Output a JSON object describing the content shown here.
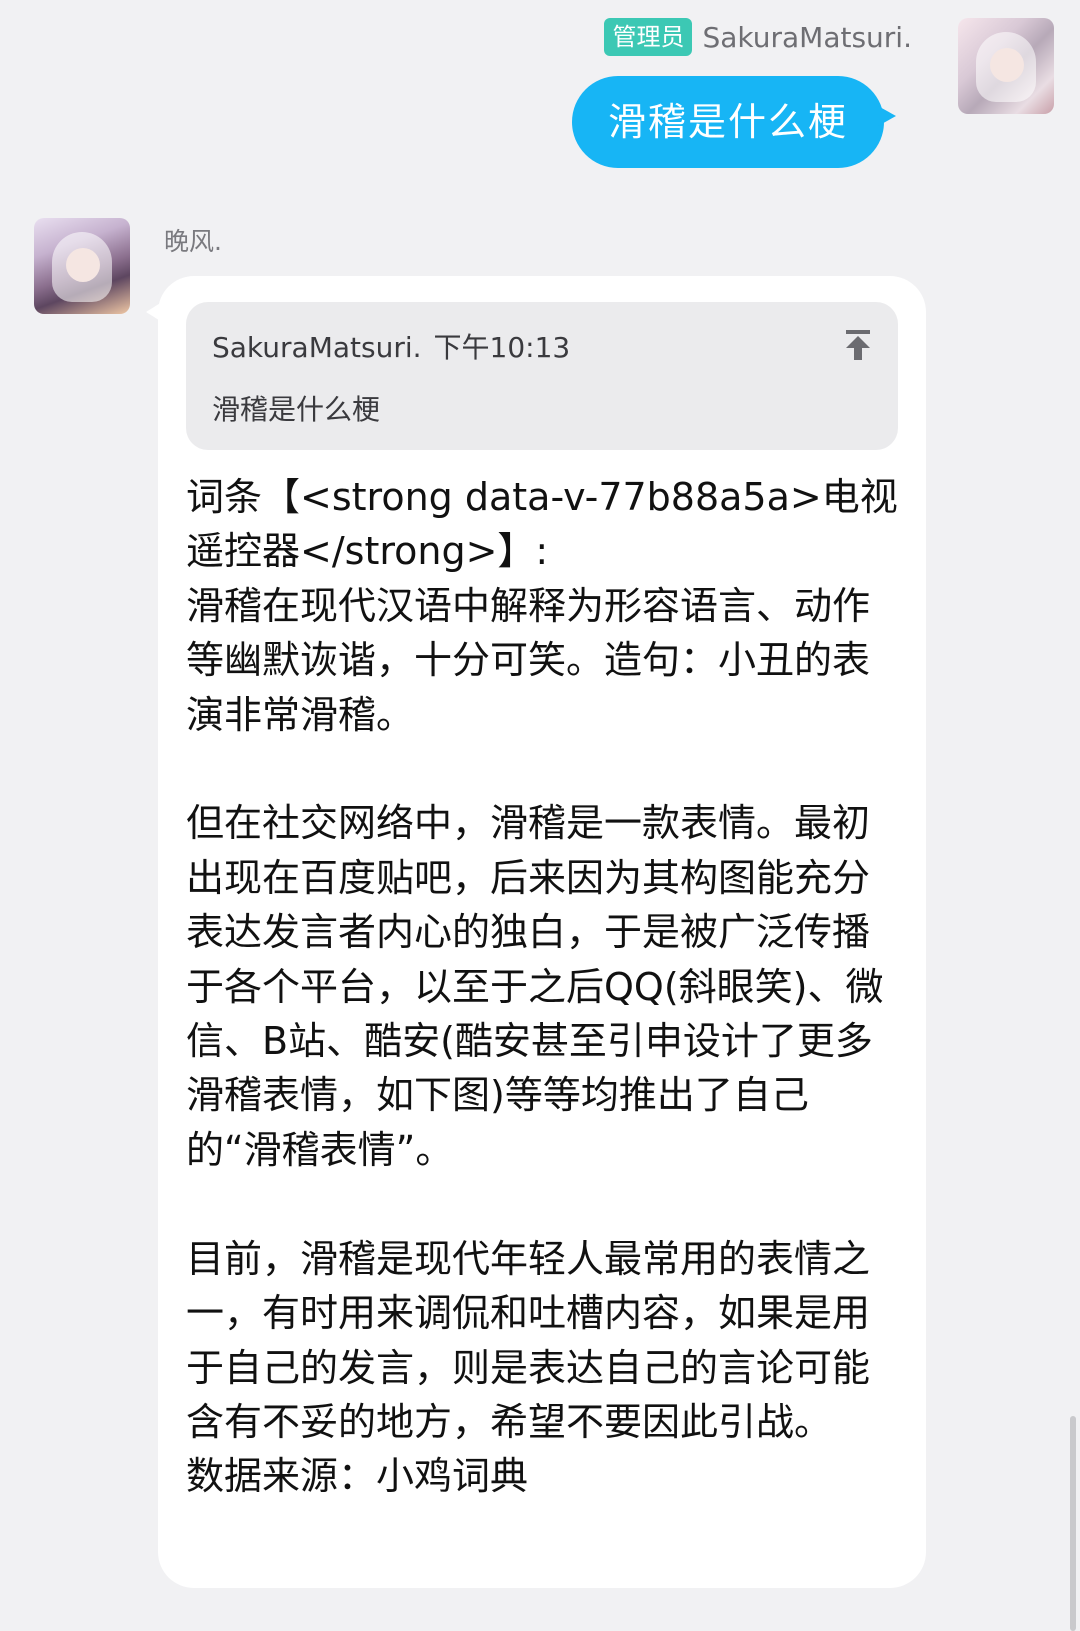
{
  "me": {
    "badge": "管理员",
    "name": "SakuraMatsuri.",
    "message": "滑稽是什么梗"
  },
  "other": {
    "name": "晚风.",
    "quote": {
      "author": "SakuraMatsuri.",
      "time": "下午10:13",
      "text": "滑稽是什么梗",
      "icon": "jump-to-top-icon"
    },
    "reply": "词条【<strong data-v-77b88a5a>电视遥控器</strong>】:\n滑稽在现代汉语中解释为形容语言、动作等幽默诙谐，十分可笑。造句：小丑的表演非常滑稽。\n\n但在社交网络中，滑稽是一款表情。最初出现在百度贴吧，后来因为其构图能充分表达发言者内心的独白，于是被广泛传播于各个平台，以至于之后QQ(斜眼笑)、微信、B站、酷安(酷安甚至引申设计了更多滑稽表情，如下图)等等均推出了自己的“滑稽表情”。\n\n目前，滑稽是现代年轻人最常用的表情之一，有时用来调侃和吐槽内容，如果是用于自己的发言，则是表达自己的言论可能含有不妥的地方，希望不要因此引战。\n数据来源：小鸡词典"
  },
  "colors": {
    "background": "#f1f1f3",
    "sent_bubble": "#17b5f5",
    "admin_badge": "#3cc8b4"
  }
}
